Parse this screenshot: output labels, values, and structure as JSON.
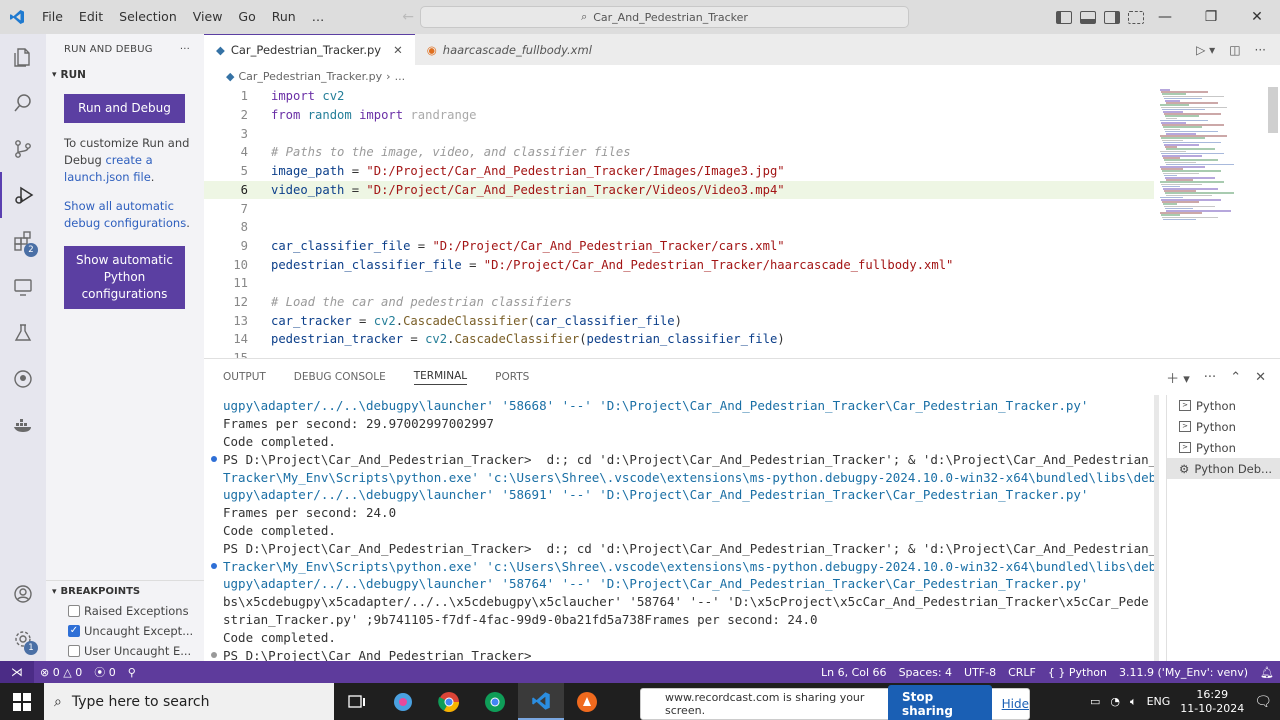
{
  "titlebar": {
    "menus": [
      "File",
      "Edit",
      "Selection",
      "View",
      "Go",
      "Run",
      "…"
    ],
    "command_center": "Car_And_Pedestrian_Tracker"
  },
  "sidebar": {
    "header": "RUN AND DEBUG",
    "run_section": "RUN",
    "run_button": "Run and Debug",
    "customize_text_1": "To customize Run and Debug",
    "customize_link": "create a launch.json file",
    "customize_end": ".",
    "show_all_link": "Show all automatic debug configurations",
    "show_all_end": ".",
    "python_config_button": "Show automatic Python configurations",
    "breakpoints_header": "BREAKPOINTS",
    "breakpoints": [
      {
        "label": "Raised Exceptions",
        "checked": false
      },
      {
        "label": "Uncaught Except...",
        "checked": true
      },
      {
        "label": "User Uncaught E...",
        "checked": false
      }
    ]
  },
  "activity_badges": {
    "extensions": "2",
    "manage": "1"
  },
  "tabs": [
    {
      "label": "Car_Pedestrian_Tracker.py",
      "active": true
    },
    {
      "label": "haarcascade_fullbody.xml",
      "active": false
    }
  ],
  "breadcrumb": {
    "file": "Car_Pedestrian_Tracker.py",
    "more": "..."
  },
  "code_lines": [
    {
      "n": "1",
      "html": "<span class='kw'>import</span> <span class='mod'>cv2</span>"
    },
    {
      "n": "2",
      "html": "<span class='kw'>from</span> <span class='mod'>random</span> <span class='kw'>import</span> <span class='dim'>randrange</span>"
    },
    {
      "n": "3",
      "html": ""
    },
    {
      "n": "4",
      "html": "<span class='cm'># Paths to the image, video, and classifier files</span>"
    },
    {
      "n": "5",
      "html": "<span class='var'>image_path</span> = <span class='str'>\"D:/Project/Car_And_Pedestrian_Tracker/Images/Image3.jpg\"</span>"
    },
    {
      "n": "6",
      "html": "<span class='var'>video_path</span> = <span class='str'>\"D:/Project/Car_And_Pedestrian_Tracker/Videos/Video3.mp4\"</span>"
    },
    {
      "n": "7",
      "html": ""
    },
    {
      "n": "8",
      "html": ""
    },
    {
      "n": "9",
      "html": "<span class='var'>car_classifier_file</span> = <span class='str'>\"D:/Project/Car_And_Pedestrian_Tracker/cars.xml\"</span>"
    },
    {
      "n": "10",
      "html": "<span class='var'>pedestrian_classifier_file</span> = <span class='str'>\"D:/Project/Car_And_Pedestrian_Tracker/haarcascade_fullbody.xml\"</span>"
    },
    {
      "n": "11",
      "html": ""
    },
    {
      "n": "12",
      "html": "<span class='cm'># Load the car and pedestrian classifiers</span>"
    },
    {
      "n": "13",
      "html": "<span class='var'>car_tracker</span> = <span class='mod'>cv2</span>.<span class='fn'>CascadeClassifier</span>(<span class='var'>car_classifier_file</span>)"
    },
    {
      "n": "14",
      "html": "<span class='var'>pedestrian_tracker</span> = <span class='mod'>cv2</span>.<span class='fn'>CascadeClassifier</span>(<span class='var'>pedestrian_classifier_file</span>)"
    },
    {
      "n": "15",
      "html": ""
    }
  ],
  "current_line": "6",
  "panel_tabs": [
    "OUTPUT",
    "DEBUG CONSOLE",
    "TERMINAL",
    "PORTS"
  ],
  "active_panel_tab": "TERMINAL",
  "terminal_lines": [
    {
      "text": "ugpy\\adapter/../..\\debugpy\\launcher' '58668' '--' 'D:\\Project\\Car_And_Pedestrian_Tracker\\Car_Pedestrian_Tracker.py'",
      "cont": true,
      "dot": ""
    },
    {
      "text": "Frames per second: 29.97002997002997",
      "cont": false,
      "dot": ""
    },
    {
      "text": "Code completed.",
      "cont": false,
      "dot": ""
    },
    {
      "text": "PS D:\\Project\\Car_And_Pedestrian_Tracker>  d:; cd 'd:\\Project\\Car_And_Pedestrian_Tracker'; & 'd:\\Project\\Car_And_Pedestrian_",
      "cont": false,
      "dot": "blue"
    },
    {
      "text": "Tracker\\My_Env\\Scripts\\python.exe' 'c:\\Users\\Shree\\.vscode\\extensions\\ms-python.debugpy-2024.10.0-win32-x64\\bundled\\libs\\deb",
      "cont": true,
      "dot": ""
    },
    {
      "text": "ugpy\\adapter/../..\\debugpy\\launcher' '58691' '--' 'D:\\Project\\Car_And_Pedestrian_Tracker\\Car_Pedestrian_Tracker.py'",
      "cont": true,
      "dot": ""
    },
    {
      "text": "Frames per second: 24.0",
      "cont": false,
      "dot": ""
    },
    {
      "text": "Code completed.",
      "cont": false,
      "dot": ""
    },
    {
      "text": "PS D:\\Project\\Car_And_Pedestrian_Tracker>  d:; cd 'd:\\Project\\Car_And_Pedestrian_Tracker'; & 'd:\\Project\\Car_And_Pedestrian_",
      "cont": false,
      "dot": ""
    },
    {
      "text": "Tracker\\My_Env\\Scripts\\python.exe' 'c:\\Users\\Shree\\.vscode\\extensions\\ms-python.debugpy-2024.10.0-win32-x64\\bundled\\libs\\deb",
      "cont": true,
      "dot": "blue"
    },
    {
      "text": "ugpy\\adapter/../..\\debugpy\\launcher' '58764' '--' 'D:\\Project\\Car_And_Pedestrian_Tracker\\Car_Pedestrian_Tracker.py'",
      "cont": true,
      "dot": ""
    },
    {
      "text": "bs\\x5cdebugpy\\x5cadapter/../..\\x5cdebugpy\\x5claucher' '58764' '--' 'D:\\x5cProject\\x5cCar_And_Pedestrian_Tracker\\x5cCar_Pede",
      "cont": false,
      "dot": ""
    },
    {
      "text": "strian_Tracker.py' ;9b741105-f7df-4fac-99d9-0ba21fd5a738Frames per second: 24.0",
      "cont": false,
      "dot": ""
    },
    {
      "text": "Code completed.",
      "cont": false,
      "dot": ""
    },
    {
      "text": "PS D:\\Project\\Car_And_Pedestrian_Tracker> ",
      "cont": false,
      "dot": "grey"
    }
  ],
  "terminal_list": [
    {
      "label": "Python",
      "active": false
    },
    {
      "label": "Python",
      "active": false
    },
    {
      "label": "Python",
      "active": false
    },
    {
      "label": "Python Deb...",
      "active": true
    }
  ],
  "statusbar": {
    "errors": "0",
    "warnings": "0",
    "ports": "0",
    "position": "Ln 6, Col 66",
    "spaces": "Spaces: 4",
    "encoding": "UTF-8",
    "eol": "CRLF",
    "language": "Python",
    "interpreter": "3.11.9 ('My_Env': venv)"
  },
  "taskbar": {
    "search_placeholder": "Type here to search",
    "share_text": "www.recordcast.com is sharing your screen.",
    "stop_sharing": "Stop sharing",
    "hide": "Hide",
    "lang": "ENG",
    "time": "16:29",
    "date": "11-10-2024"
  },
  "colors": {
    "accent": "#5b3fa2",
    "statusbar": "#5e3b9c",
    "link": "#2e5fbe"
  }
}
